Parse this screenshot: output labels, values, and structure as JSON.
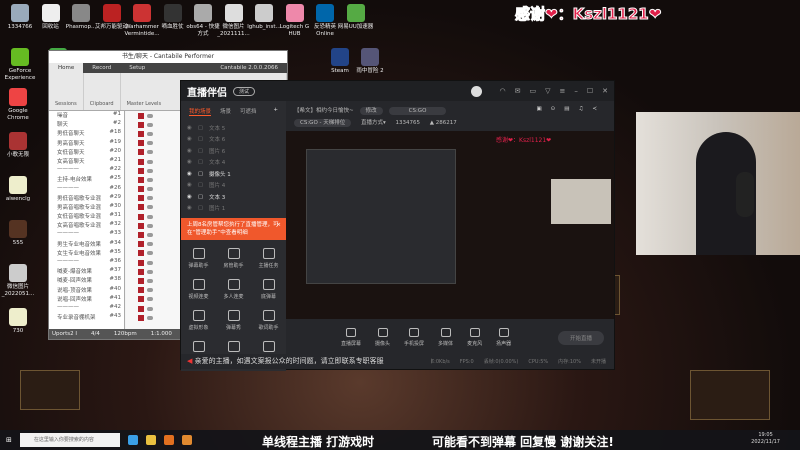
{
  "overlay": {
    "thanks": "感谢❤：Kszl1121❤"
  },
  "desktop": {
    "top_icons": [
      "1334766",
      "回收站",
      "Phasmop...",
      "艾邦万能驱动",
      "Warhammer Vermintide...",
      "嘀血胜仗",
      "obs64 - 快捷方式",
      "微信图片_2021111...",
      "lghub_inst...",
      "Logitech G HUB",
      "反恐精英Online",
      "网易UU加速器"
    ],
    "row2_icons": [
      "GeForce Experience",
      "KO...",
      "Steam",
      "雨中冒险 2"
    ],
    "left_icons": [
      "Google Chrome",
      "小歌无限",
      "aiwenclg",
      "555",
      "微信图片_2022051...",
      "730"
    ]
  },
  "cantabile": {
    "title": "书生/聊天 - Cantabile Performer",
    "tabs": [
      "Home",
      "Record",
      "Setup"
    ],
    "version": "Cantabile 2.0.0.2066",
    "ribbon_groups": [
      "Sessions",
      "Clipboard",
      "Master Levels"
    ],
    "songs": [
      [
        "噪音",
        "#1"
      ],
      [
        "聊天",
        "#2"
      ],
      [
        "男低音聊天",
        "#18"
      ],
      [
        "男高音聊天",
        "#19"
      ],
      [
        "女低音聊天",
        "#20"
      ],
      [
        "女高音聊天",
        "#21"
      ],
      [
        "————",
        "#22"
      ],
      [
        "主持-电台效果",
        "#25"
      ],
      [
        "————",
        "#26"
      ],
      [
        "男低音唱歌专业混",
        "#29"
      ],
      [
        "男高音唱歌专业混",
        "#30"
      ],
      [
        "女低音唱歌专业混",
        "#31"
      ],
      [
        "女高音唱歌专业混",
        "#32"
      ],
      [
        "————",
        "#33"
      ],
      [
        "男生专业电音效果",
        "#34"
      ],
      [
        "女生专业电音效果",
        "#35"
      ],
      [
        "————",
        "#36"
      ],
      [
        "喊麦-爆音效果",
        "#37"
      ],
      [
        "喊麦-回声效果",
        "#38"
      ],
      [
        "说唱-顶音效果",
        "#40"
      ],
      [
        "说唱-回声效果",
        "#41"
      ],
      [
        "————",
        "#42"
      ],
      [
        "专业录音棚机架",
        "#43"
      ]
    ],
    "status": [
      "Uports2 I",
      "4/4",
      "120bpm",
      "1:1.000",
      "Stopped"
    ]
  },
  "zhibo": {
    "logo": "直播伴侣",
    "beta": "测试",
    "scene_tabs": [
      "我的场景",
      "场景",
      "可遮挡"
    ],
    "sources": [
      [
        "文本 5",
        false
      ],
      [
        "文本 6",
        false
      ],
      [
        "图片 6",
        false
      ],
      [
        "文本 4",
        false
      ],
      [
        "摄像头 1",
        true
      ],
      [
        "图片 4",
        false
      ],
      [
        "文本 3",
        true
      ],
      [
        "图片 1",
        false
      ]
    ],
    "notice": "上周8名房管帮您执行了直播管理，可在“管理助手”中查看明细",
    "tools": [
      "弹幕助手",
      "房管助手",
      "主播任务",
      "视频连麦",
      "多人连麦",
      "底弹幕",
      "虚拟形象",
      "弹幕秀",
      "歌词助手",
      "",
      "",
      ""
    ],
    "room_title": "【希文】相约今日愉快~",
    "edit": "修改",
    "category": "CS:GO",
    "mode": "CS:GO - 天梯排位",
    "live_mode": "直播方式▾",
    "fans": "1334765",
    "heat": "286217",
    "controls": [
      "直播屏幕",
      "摄像头",
      "手机投屏",
      "多媒体",
      "麦克风",
      "扬声器"
    ],
    "start": "开始直播",
    "stats": [
      "码率:0Kb/s",
      "FPS:0",
      "丢帧:0(0.00%)",
      "CPU:5%",
      "内存:10%",
      "未开播"
    ],
    "tip": "亲爱的主播，如遇文案报公众的时间题，请立即联系专职客服"
  },
  "taskbar": {
    "search": "在这里输入你要搜索的内容",
    "time": "19:05",
    "date": "2022/11/17"
  },
  "subtitles": [
    "单线程主播 打游戏时",
    "可能看不到弹幕 回复慢 谢谢关注!"
  ]
}
